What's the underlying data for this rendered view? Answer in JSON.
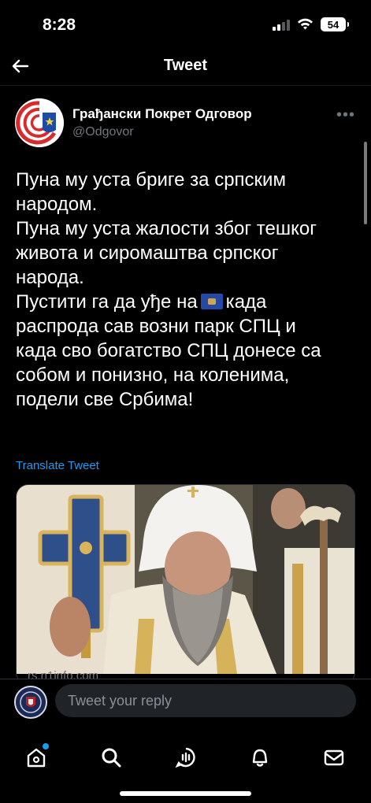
{
  "status_bar": {
    "time": "8:28",
    "battery": "54"
  },
  "header": {
    "title": "Tweet",
    "back_icon": "arrow-left-icon"
  },
  "tweet": {
    "author_name": "Грађански Покрет Одговор",
    "author_handle": "@Odgovor",
    "more_icon": "more-dots-icon",
    "text_lines": [
      "Пуна му уста бриге за српским",
      "народом.",
      "Пуна му уста жалости због тешког",
      "живота и сиромаштва српског",
      "народа.",
      "Пустити га да уђе на",
      "када",
      "распрода сав возни парк СПЦ и",
      "када сво богатство СПЦ донесе са",
      "собом и понизно, на коленима,",
      "подели све Србима!"
    ],
    "emoji_name": "kosovo-flag-emoji",
    "translate_label": "Translate Tweet",
    "card_domain": "rs.n1info.com"
  },
  "reply": {
    "placeholder": "Tweet your reply"
  },
  "tabs": [
    {
      "icon": "home-icon"
    },
    {
      "icon": "search-icon"
    },
    {
      "icon": "spaces-icon"
    },
    {
      "icon": "notifications-bell-icon"
    },
    {
      "icon": "messages-envelope-icon"
    }
  ],
  "colors": {
    "background": "#000000",
    "accent": "#1d9bf0",
    "secondary_text": "#71767b"
  }
}
